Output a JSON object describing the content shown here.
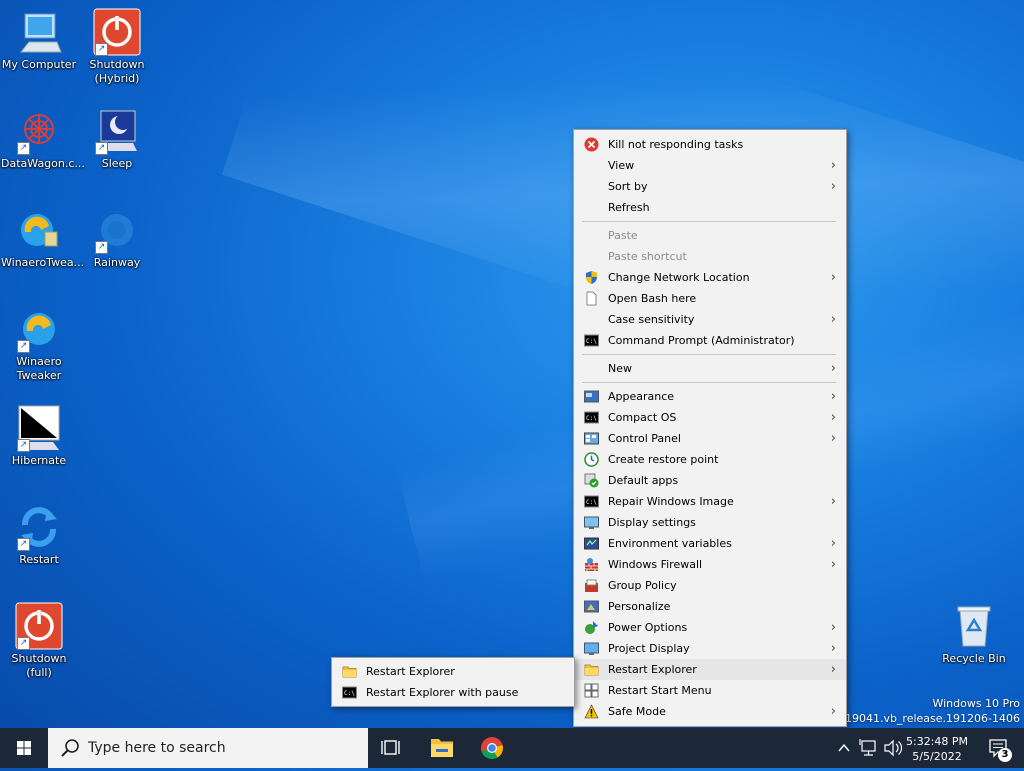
{
  "desktop": {
    "icons": [
      {
        "label": "My Computer"
      },
      {
        "label": "Shutdown (Hybrid)"
      },
      {
        "label": "DataWagon.c..."
      },
      {
        "label": "Sleep"
      },
      {
        "label": "WinaeroTwea..."
      },
      {
        "label": "Rainway"
      },
      {
        "label": "Winaero Tweaker"
      },
      {
        "label": "Hibernate"
      },
      {
        "label": "Restart"
      },
      {
        "label": "Shutdown (full)"
      },
      {
        "label": "Recycle Bin"
      }
    ],
    "watermark": {
      "line1": "Windows 10 Pro",
      "line2": "Build 19041.vb_release.191206-1406"
    }
  },
  "context_menu": {
    "items": [
      {
        "label": "Kill not responding tasks",
        "icon": "kill-icon"
      },
      {
        "label": "View"
      },
      {
        "label": "Sort by"
      },
      {
        "label": "Refresh"
      },
      {
        "label": "Paste"
      },
      {
        "label": "Paste shortcut"
      },
      {
        "label": "Change Network Location",
        "icon": "shield-icon"
      },
      {
        "label": "Open Bash here",
        "icon": "document-icon"
      },
      {
        "label": "Case sensitivity"
      },
      {
        "label": "Command Prompt (Administrator)",
        "icon": "cmd-icon"
      },
      {
        "label": "New"
      },
      {
        "label": "Appearance",
        "icon": "appearance-icon"
      },
      {
        "label": "Compact OS",
        "icon": "cmd-icon"
      },
      {
        "label": "Control Panel",
        "icon": "control-panel-icon"
      },
      {
        "label": "Create restore point",
        "icon": "restore-point-icon"
      },
      {
        "label": "Default apps",
        "icon": "default-apps-icon"
      },
      {
        "label": "Repair Windows Image",
        "icon": "cmd-icon"
      },
      {
        "label": "Display settings",
        "icon": "display-icon"
      },
      {
        "label": "Environment variables",
        "icon": "env-vars-icon"
      },
      {
        "label": "Windows Firewall",
        "icon": "firewall-icon"
      },
      {
        "label": "Group Policy",
        "icon": "group-policy-icon"
      },
      {
        "label": "Personalize",
        "icon": "personalize-icon"
      },
      {
        "label": "Power Options",
        "icon": "power-options-icon"
      },
      {
        "label": "Project Display",
        "icon": "project-display-icon"
      },
      {
        "label": "Restart Explorer",
        "icon": "folder-icon"
      },
      {
        "label": "Restart Start Menu",
        "icon": "start-menu-icon"
      },
      {
        "label": "Safe Mode",
        "icon": "warning-icon"
      }
    ]
  },
  "submenu": {
    "items": [
      {
        "label": "Restart Explorer",
        "icon": "folder-icon"
      },
      {
        "label": "Restart Explorer with pause",
        "icon": "cmd-icon"
      }
    ]
  },
  "taskbar": {
    "search_placeholder": "Type here to search",
    "time": "5:32:48 PM",
    "date": "5/5/2022",
    "notification_count": "3"
  },
  "colors": {
    "accent": "#0b62c9",
    "taskbar": "#1c2737",
    "menu_bg": "#f2f2f2",
    "highlight": "#e6e6e6"
  }
}
